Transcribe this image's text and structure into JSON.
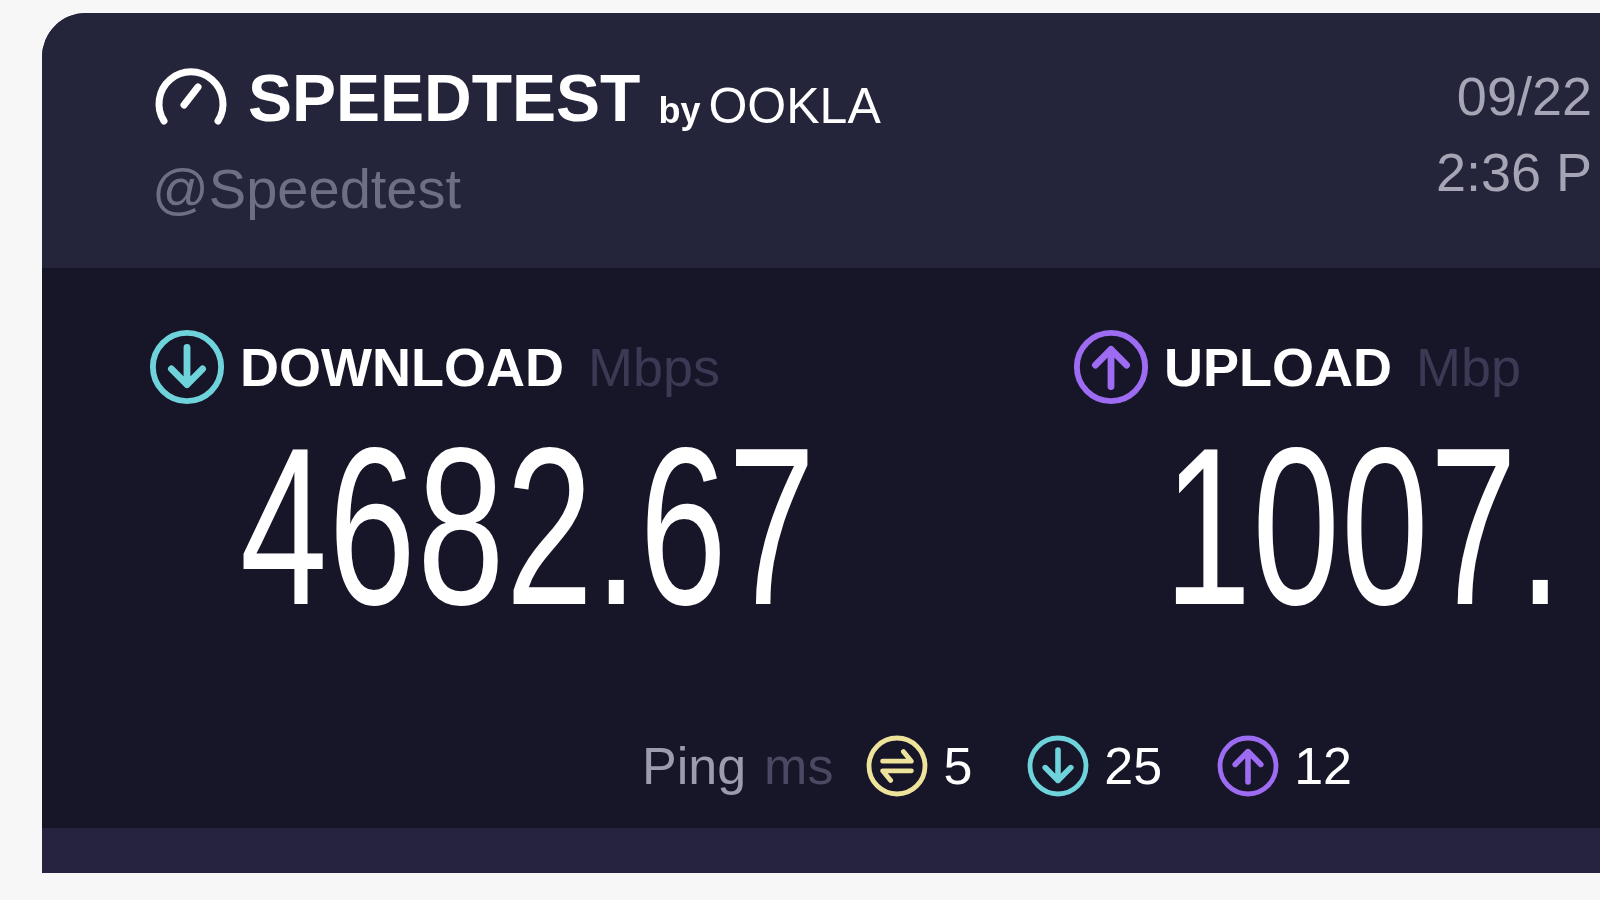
{
  "brand": {
    "name": "SPEEDTEST",
    "by": "by",
    "maker": "OOKLA"
  },
  "handle": "@Speedtest",
  "date": "09/22",
  "time": "2:36 P",
  "results": [
    {
      "kind": "download",
      "label": "DOWNLOAD",
      "unit": "Mbps",
      "value": "4682.67"
    },
    {
      "kind": "upload",
      "label": "UPLOAD",
      "unit": "Mbp",
      "value": "1007."
    }
  ],
  "ping": {
    "label": "Ping",
    "unit": "ms",
    "items": [
      {
        "kind": "idle",
        "value": "5"
      },
      {
        "kind": "download",
        "value": "25"
      },
      {
        "kind": "upload",
        "value": "12"
      }
    ]
  }
}
